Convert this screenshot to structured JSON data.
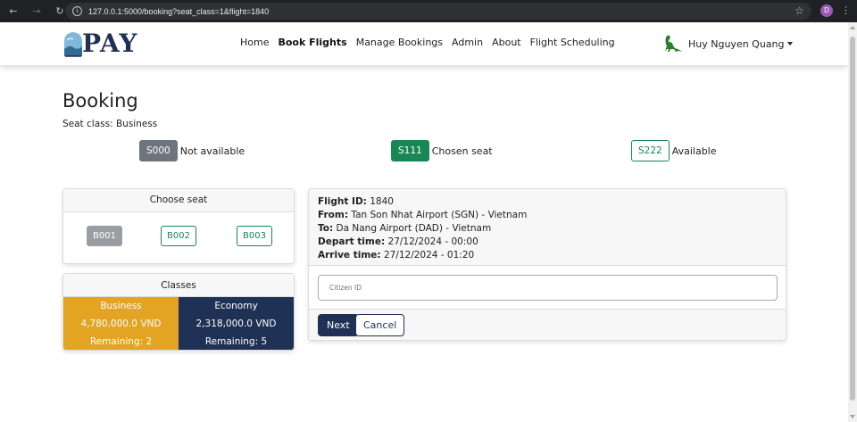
{
  "browser": {
    "url": "127.0.0.1:5000/booking?seat_class=1&flight=1840",
    "profile_initial": "D"
  },
  "nav": {
    "logo_text": "PAY",
    "links": [
      "Home",
      "Book Flights",
      "Manage Bookings",
      "Admin",
      "About",
      "Flight Scheduling"
    ],
    "active": "Book Flights",
    "user_name": "Huy Nguyen Quang"
  },
  "page": {
    "title": "Booking",
    "seat_class": "Seat class: Business"
  },
  "legend": [
    {
      "seat": "S000",
      "label": "Not available",
      "state": "not-available"
    },
    {
      "seat": "S111",
      "label": "Chosen seat",
      "state": "chosen"
    },
    {
      "seat": "S222",
      "label": "Available",
      "state": "available"
    }
  ],
  "choose_seat": {
    "header": "Choose seat",
    "seats": [
      {
        "label": "B001",
        "state": "not-available"
      },
      {
        "label": "B002",
        "state": "available"
      },
      {
        "label": "B003",
        "state": "available"
      }
    ]
  },
  "classes": {
    "header": "Classes",
    "items": [
      {
        "name": "Business",
        "price": "4,780,000.0 VND",
        "remaining": "Remaining: 2",
        "color": "#e3a323"
      },
      {
        "name": "Economy",
        "price": "2,318,000.0 VND",
        "remaining": "Remaining: 5",
        "color": "#1f3154"
      }
    ]
  },
  "flight": {
    "id_label": "Flight ID:",
    "id_value": "1840",
    "from_label": "From:",
    "from_value": "Tan Son Nhat Airport (SGN) - Vietnam",
    "to_label": "To:",
    "to_value": "Da Nang Airport (DAD) - Vietnam",
    "depart_label": "Depart time:",
    "depart_value": "27/12/2024 - 00:00",
    "arrive_label": "Arrive time:",
    "arrive_value": "27/12/2024 - 01:20"
  },
  "form": {
    "citizen_id_placeholder": "Citizen ID",
    "next_label": "Next",
    "cancel_label": "Cancel"
  },
  "colors": {
    "primary": "#1f3154",
    "accent": "#e3a323",
    "success": "#198754",
    "secondary": "#6c757d"
  }
}
